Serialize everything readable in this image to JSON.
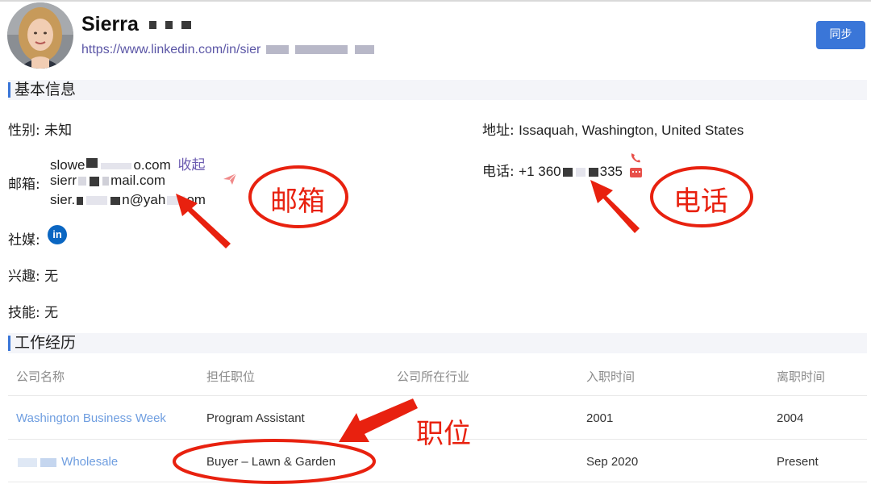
{
  "profile": {
    "name": "Sierra",
    "url": "https://www.linkedin.com/in/sier",
    "sync_label": "同步"
  },
  "basic_info": {
    "section_title": "基本信息",
    "gender_label": "性别:",
    "gender_value": "未知",
    "address_label": "地址:",
    "address_value": "Issaquah, Washington, United States",
    "email_label": "邮箱:",
    "email_1_start": "slowe",
    "email_1_end": "o.com",
    "collapse_label": "收起",
    "email_2_start": "sierr",
    "email_2_end": "mail.com",
    "email_3_start": "sier.",
    "email_3_mid": "n@yah",
    "email_3_end": "om",
    "phone_label": "电话:",
    "phone_start": "+1 360",
    "phone_end": "335",
    "social_label": "社媒:",
    "linkedin_glyph": "in",
    "interest_label": "兴趣:",
    "interest_value": "无",
    "skill_label": "技能:",
    "skill_value": "无"
  },
  "work_history": {
    "section_title": "工作经历",
    "columns": [
      "公司名称",
      "担任职位",
      "公司所在行业",
      "入职时间",
      "离职时间"
    ],
    "rows": [
      {
        "company": "Washington Business Week",
        "position": "Program Assistant",
        "industry": "",
        "start": "2001",
        "end": "2004"
      },
      {
        "company": "Wholesale",
        "position": "Buyer – Lawn & Garden",
        "industry": "",
        "start": "Sep 2020",
        "end": "Present"
      }
    ]
  },
  "annotations": {
    "email": "邮箱",
    "phone": "电话",
    "position": "职位",
    "color": "#e8210f"
  },
  "colors": {
    "accent": "#3a76d8",
    "link": "#6b5bb0",
    "company_link": "#6f9ee0"
  }
}
